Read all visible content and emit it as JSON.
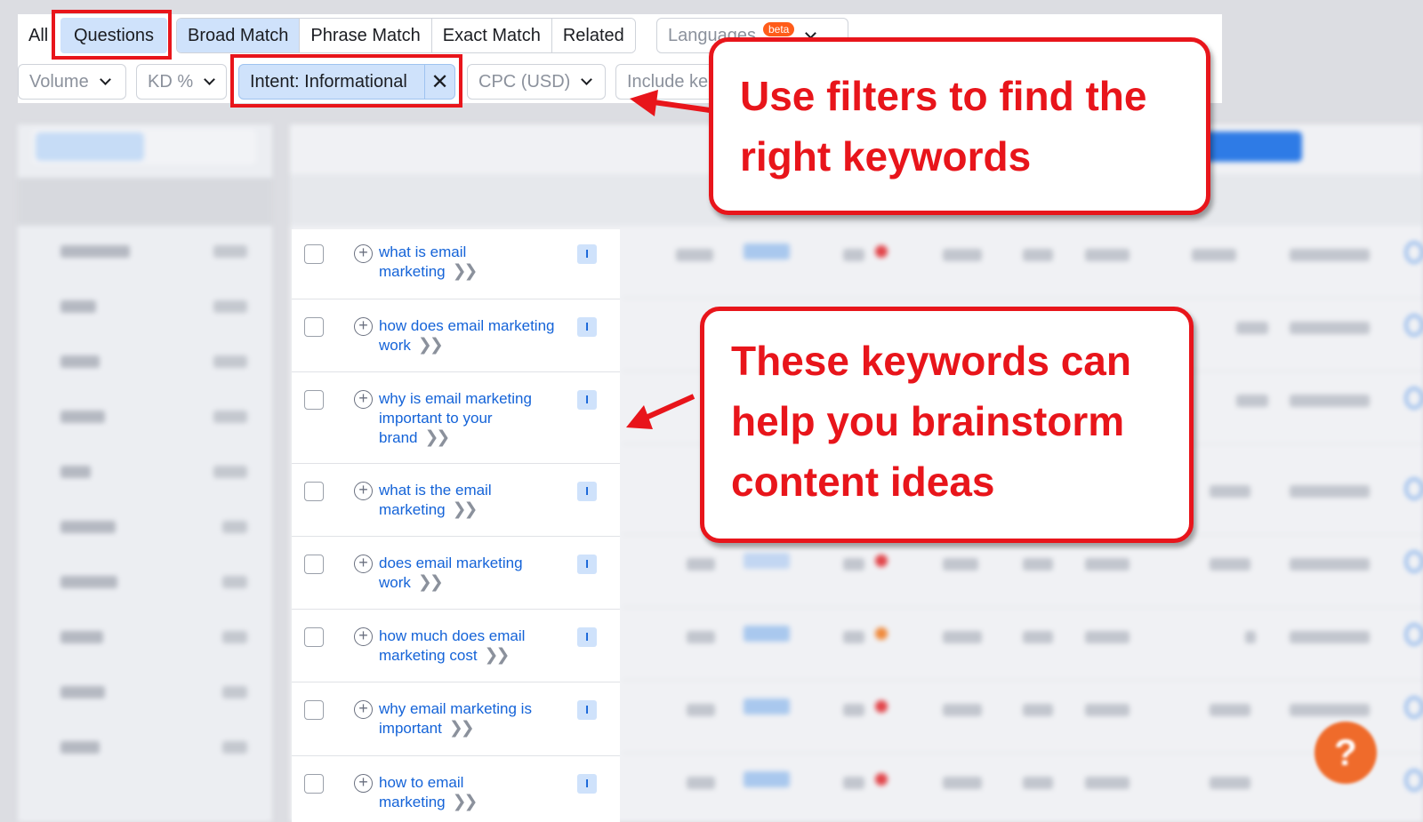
{
  "match_tabs": {
    "all": "All",
    "questions": "Questions"
  },
  "match_types": [
    "Broad Match",
    "Phrase Match",
    "Exact Match",
    "Related"
  ],
  "languages": {
    "label": "Languages",
    "badge": "beta"
  },
  "filters": {
    "volume": "Volume",
    "kd": "KD %",
    "intent": "Intent: Informational",
    "cpc": "CPC (USD)",
    "include": "Include ke"
  },
  "keywords": [
    {
      "text": "what is email marketing",
      "intent": "I"
    },
    {
      "text": "how does email marketing work",
      "intent": "I"
    },
    {
      "text": "why is email marketing important to your brand",
      "intent": "I"
    },
    {
      "text": "what is the email marketing",
      "intent": "I"
    },
    {
      "text": "does email marketing work",
      "intent": "I"
    },
    {
      "text": "how much does email marketing cost",
      "intent": "I"
    },
    {
      "text": "why email marketing is important",
      "intent": "I"
    },
    {
      "text": "how to email marketing",
      "intent": "I"
    }
  ],
  "callouts": {
    "filters": "Use filters to find the\nright keywords",
    "keywords": "These keywords can\nhelp you brainstorm\ncontent ideas"
  },
  "help_button": "?",
  "colors": {
    "annotation_red": "#e8151b",
    "link_blue": "#1463d8",
    "active_chip": "#cfe2fb"
  }
}
